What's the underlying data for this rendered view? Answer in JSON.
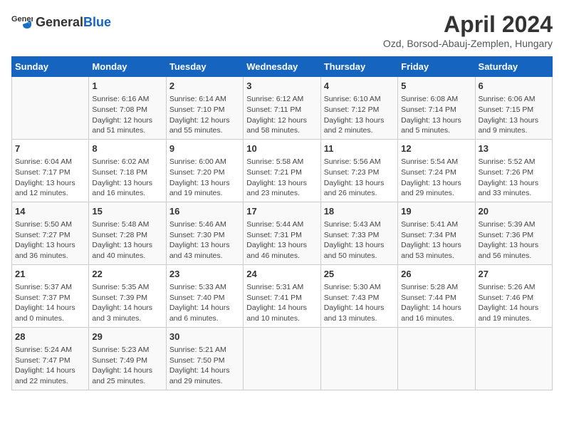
{
  "header": {
    "logo_general": "General",
    "logo_blue": "Blue",
    "title": "April 2024",
    "subtitle": "Ozd, Borsod-Abauj-Zemplen, Hungary"
  },
  "days_of_week": [
    "Sunday",
    "Monday",
    "Tuesday",
    "Wednesday",
    "Thursday",
    "Friday",
    "Saturday"
  ],
  "weeks": [
    [
      {
        "day": "",
        "content": ""
      },
      {
        "day": "1",
        "content": "Sunrise: 6:16 AM\nSunset: 7:08 PM\nDaylight: 12 hours\nand 51 minutes."
      },
      {
        "day": "2",
        "content": "Sunrise: 6:14 AM\nSunset: 7:10 PM\nDaylight: 12 hours\nand 55 minutes."
      },
      {
        "day": "3",
        "content": "Sunrise: 6:12 AM\nSunset: 7:11 PM\nDaylight: 12 hours\nand 58 minutes."
      },
      {
        "day": "4",
        "content": "Sunrise: 6:10 AM\nSunset: 7:12 PM\nDaylight: 13 hours\nand 2 minutes."
      },
      {
        "day": "5",
        "content": "Sunrise: 6:08 AM\nSunset: 7:14 PM\nDaylight: 13 hours\nand 5 minutes."
      },
      {
        "day": "6",
        "content": "Sunrise: 6:06 AM\nSunset: 7:15 PM\nDaylight: 13 hours\nand 9 minutes."
      }
    ],
    [
      {
        "day": "7",
        "content": "Sunrise: 6:04 AM\nSunset: 7:17 PM\nDaylight: 13 hours\nand 12 minutes."
      },
      {
        "day": "8",
        "content": "Sunrise: 6:02 AM\nSunset: 7:18 PM\nDaylight: 13 hours\nand 16 minutes."
      },
      {
        "day": "9",
        "content": "Sunrise: 6:00 AM\nSunset: 7:20 PM\nDaylight: 13 hours\nand 19 minutes."
      },
      {
        "day": "10",
        "content": "Sunrise: 5:58 AM\nSunset: 7:21 PM\nDaylight: 13 hours\nand 23 minutes."
      },
      {
        "day": "11",
        "content": "Sunrise: 5:56 AM\nSunset: 7:23 PM\nDaylight: 13 hours\nand 26 minutes."
      },
      {
        "day": "12",
        "content": "Sunrise: 5:54 AM\nSunset: 7:24 PM\nDaylight: 13 hours\nand 29 minutes."
      },
      {
        "day": "13",
        "content": "Sunrise: 5:52 AM\nSunset: 7:26 PM\nDaylight: 13 hours\nand 33 minutes."
      }
    ],
    [
      {
        "day": "14",
        "content": "Sunrise: 5:50 AM\nSunset: 7:27 PM\nDaylight: 13 hours\nand 36 minutes."
      },
      {
        "day": "15",
        "content": "Sunrise: 5:48 AM\nSunset: 7:28 PM\nDaylight: 13 hours\nand 40 minutes."
      },
      {
        "day": "16",
        "content": "Sunrise: 5:46 AM\nSunset: 7:30 PM\nDaylight: 13 hours\nand 43 minutes."
      },
      {
        "day": "17",
        "content": "Sunrise: 5:44 AM\nSunset: 7:31 PM\nDaylight: 13 hours\nand 46 minutes."
      },
      {
        "day": "18",
        "content": "Sunrise: 5:43 AM\nSunset: 7:33 PM\nDaylight: 13 hours\nand 50 minutes."
      },
      {
        "day": "19",
        "content": "Sunrise: 5:41 AM\nSunset: 7:34 PM\nDaylight: 13 hours\nand 53 minutes."
      },
      {
        "day": "20",
        "content": "Sunrise: 5:39 AM\nSunset: 7:36 PM\nDaylight: 13 hours\nand 56 minutes."
      }
    ],
    [
      {
        "day": "21",
        "content": "Sunrise: 5:37 AM\nSunset: 7:37 PM\nDaylight: 14 hours\nand 0 minutes."
      },
      {
        "day": "22",
        "content": "Sunrise: 5:35 AM\nSunset: 7:39 PM\nDaylight: 14 hours\nand 3 minutes."
      },
      {
        "day": "23",
        "content": "Sunrise: 5:33 AM\nSunset: 7:40 PM\nDaylight: 14 hours\nand 6 minutes."
      },
      {
        "day": "24",
        "content": "Sunrise: 5:31 AM\nSunset: 7:41 PM\nDaylight: 14 hours\nand 10 minutes."
      },
      {
        "day": "25",
        "content": "Sunrise: 5:30 AM\nSunset: 7:43 PM\nDaylight: 14 hours\nand 13 minutes."
      },
      {
        "day": "26",
        "content": "Sunrise: 5:28 AM\nSunset: 7:44 PM\nDaylight: 14 hours\nand 16 minutes."
      },
      {
        "day": "27",
        "content": "Sunrise: 5:26 AM\nSunset: 7:46 PM\nDaylight: 14 hours\nand 19 minutes."
      }
    ],
    [
      {
        "day": "28",
        "content": "Sunrise: 5:24 AM\nSunset: 7:47 PM\nDaylight: 14 hours\nand 22 minutes."
      },
      {
        "day": "29",
        "content": "Sunrise: 5:23 AM\nSunset: 7:49 PM\nDaylight: 14 hours\nand 25 minutes."
      },
      {
        "day": "30",
        "content": "Sunrise: 5:21 AM\nSunset: 7:50 PM\nDaylight: 14 hours\nand 29 minutes."
      },
      {
        "day": "",
        "content": ""
      },
      {
        "day": "",
        "content": ""
      },
      {
        "day": "",
        "content": ""
      },
      {
        "day": "",
        "content": ""
      }
    ]
  ]
}
